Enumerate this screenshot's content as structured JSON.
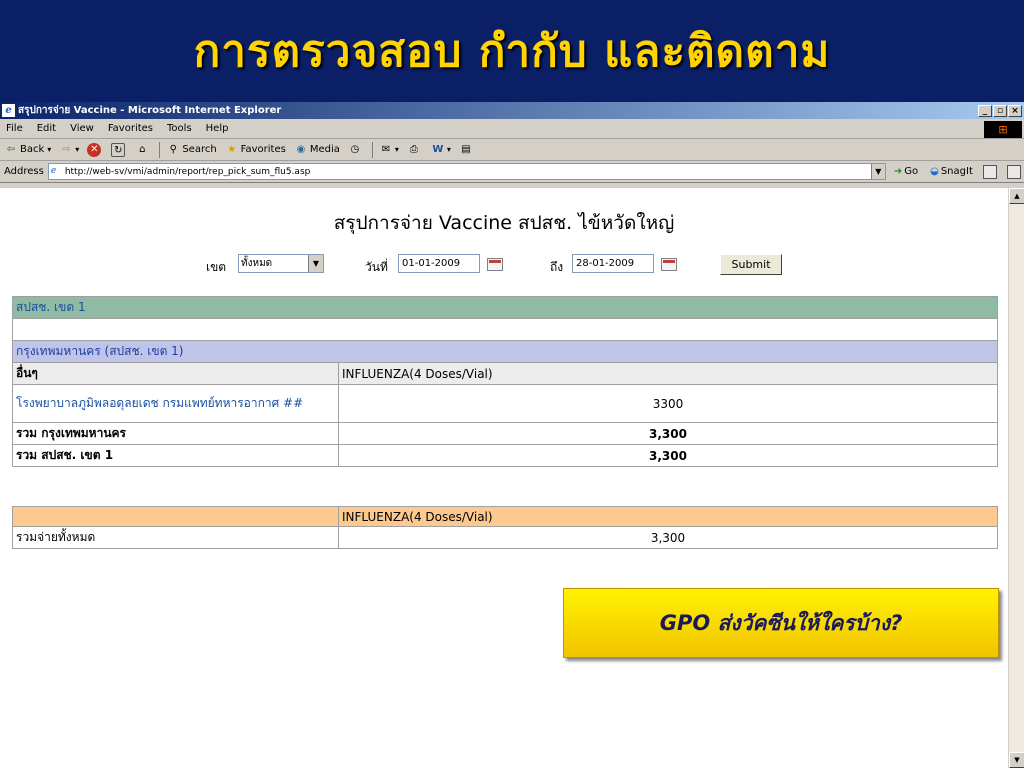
{
  "slide": {
    "title": "การตรวจสอบ กำกับ และติดตาม"
  },
  "window": {
    "title": "สรุปการจ่าย Vaccine - Microsoft Internet Explorer",
    "buttons": [
      "_",
      "▫",
      "×"
    ]
  },
  "menu": [
    "File",
    "Edit",
    "View",
    "Favorites",
    "Tools",
    "Help"
  ],
  "toolbar": {
    "back": "Back",
    "search": "Search",
    "favorites": "Favorites",
    "media": "Media"
  },
  "address": {
    "label": "Address",
    "url": "http://web-sv/vmi/admin/report/rep_pick_sum_flu5.asp",
    "go": "Go",
    "snagit": "SnagIt"
  },
  "report": {
    "title": "สรุปการจ่าย Vaccine สปสช. ไข้หวัดใหญ่",
    "filters": {
      "zone_label": "เขต",
      "zone_value": "ทั้งหมด",
      "from_label": "วันที่",
      "from_value": "01-01-2009",
      "to_label": "ถึง",
      "to_value": "28-01-2009",
      "submit": "Submit"
    },
    "zone_header": "สปสช. เขต 1",
    "province_header": "กรุงเทพมหานคร (สปสช. เขต 1)",
    "head_left": "อื่นๆ",
    "head_right": "INFLUENZA(4 Doses/Vial)",
    "item_name": "โรงพยาบาลภูมิพลอดุลยเดช กรมแพทย์ทหารอากาศ ##",
    "item_value": "3300",
    "province_total_label": "รวม กรุงเทพมหานคร",
    "province_total_value": "3,300",
    "zone_total_label": "รวม สปสช. เขต 1",
    "zone_total_value": "3,300",
    "summary_head": "INFLUENZA(4 Doses/Vial)",
    "summary_label": "รวมจ่ายทั้งหมด",
    "summary_value": "3,300"
  },
  "callout": "GPO ส่งวัคซีนให้ใครบ้าง?"
}
